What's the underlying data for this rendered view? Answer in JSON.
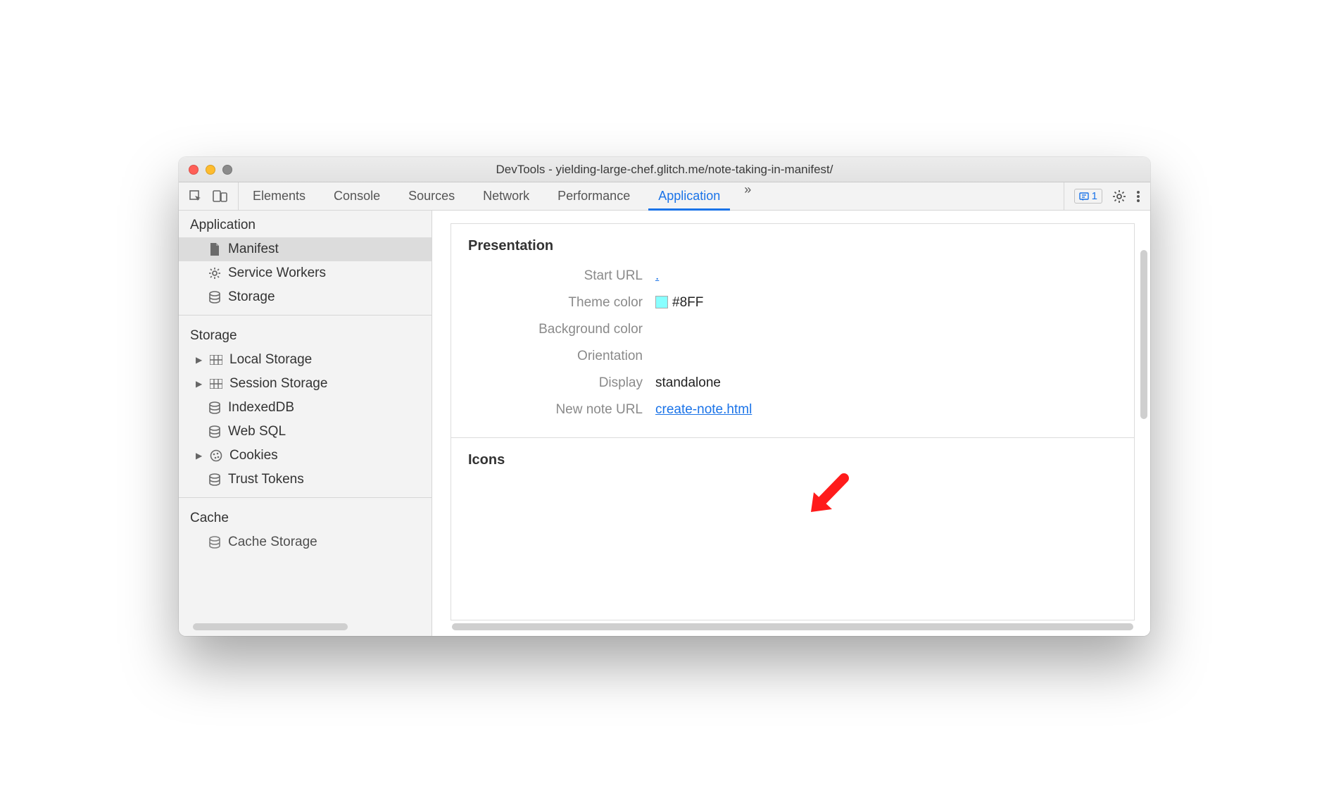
{
  "window": {
    "title": "DevTools - yielding-large-chef.glitch.me/note-taking-in-manifest/"
  },
  "toolbar": {
    "tabs": [
      "Elements",
      "Console",
      "Sources",
      "Network",
      "Performance",
      "Application"
    ],
    "selected_tab": "Application",
    "more_glyph": "»",
    "badge_count": "1"
  },
  "sidebar": {
    "groups": [
      {
        "title": "Application",
        "items": [
          {
            "icon": "file-icon",
            "label": "Manifest",
            "selected": true
          },
          {
            "icon": "gear-icon",
            "label": "Service Workers"
          },
          {
            "icon": "storage-icon",
            "label": "Storage"
          }
        ]
      },
      {
        "title": "Storage",
        "items": [
          {
            "icon": "grid-icon",
            "label": "Local Storage",
            "expander": true
          },
          {
            "icon": "grid-icon",
            "label": "Session Storage",
            "expander": true
          },
          {
            "icon": "storage-icon",
            "label": "IndexedDB"
          },
          {
            "icon": "storage-icon",
            "label": "Web SQL"
          },
          {
            "icon": "cookie-icon",
            "label": "Cookies",
            "expander": true
          },
          {
            "icon": "storage-icon",
            "label": "Trust Tokens"
          }
        ]
      },
      {
        "title": "Cache",
        "items": [
          {
            "icon": "storage-icon",
            "label": "Cache Storage"
          }
        ]
      }
    ]
  },
  "main": {
    "section_presentation_title": "Presentation",
    "rows": {
      "start_url": {
        "label": "Start URL",
        "link": "."
      },
      "theme_color": {
        "label": "Theme color",
        "value": "#8FF",
        "swatch": "#88ffff"
      },
      "background_color": {
        "label": "Background color",
        "value": ""
      },
      "orientation": {
        "label": "Orientation",
        "value": ""
      },
      "display": {
        "label": "Display",
        "value": "standalone"
      },
      "new_note_url": {
        "label": "New note URL",
        "link": "create-note.html"
      }
    },
    "section_icons_title": "Icons"
  }
}
